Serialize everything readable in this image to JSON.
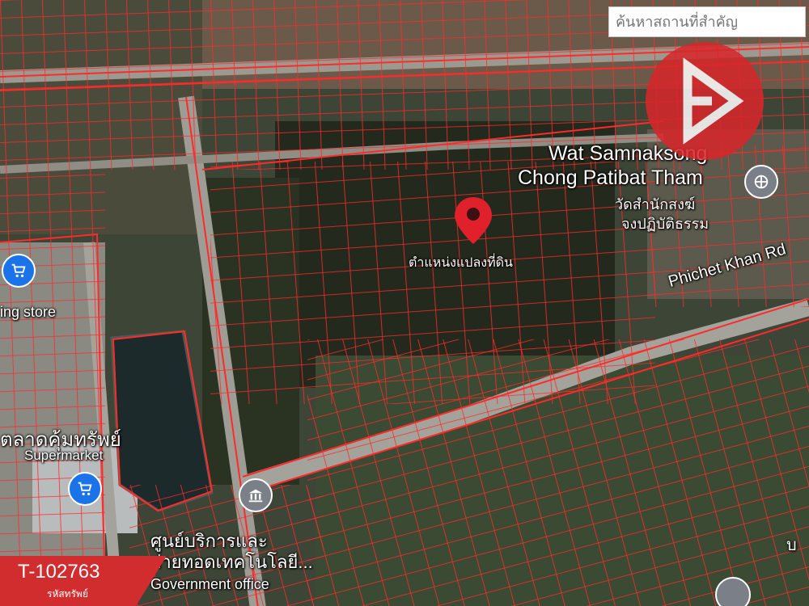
{
  "search": {
    "placeholder": "ค้นหาสถานที่สำคัญ"
  },
  "marker": {
    "label": "ตำแหน่งแปลงที่ดิน",
    "color": "#e0202b"
  },
  "places": {
    "temple_en_1": "Wat Samnaksong",
    "temple_en_2": "Chong Patibat Tham",
    "temple_th_1": "วัดสำนักสงฆ์",
    "temple_th_2": "จงปฏิบัติธรรม",
    "road": "Phichet Khan Rd",
    "store": "ing store",
    "market_th": "ตลาดคุ้มทรัพย์",
    "market_en": "Supermarket",
    "office_th_1": "ศูนย์บริการและ",
    "office_th_2": "ถ่ายทอดเทคโนโลยี...",
    "office_en": "Government office",
    "partial_edge": "บ"
  },
  "property": {
    "code": "T-102763",
    "caption": "รหัสทรัพย์"
  },
  "colors": {
    "parcel_lines": "#ff2a2a",
    "brand": "#d12d2f",
    "poi": "#1a73e8"
  },
  "icons": {
    "logo": "brand-logo",
    "shopping": "shopping-cart-icon",
    "government": "government-building-icon",
    "temple": "temple-icon"
  }
}
